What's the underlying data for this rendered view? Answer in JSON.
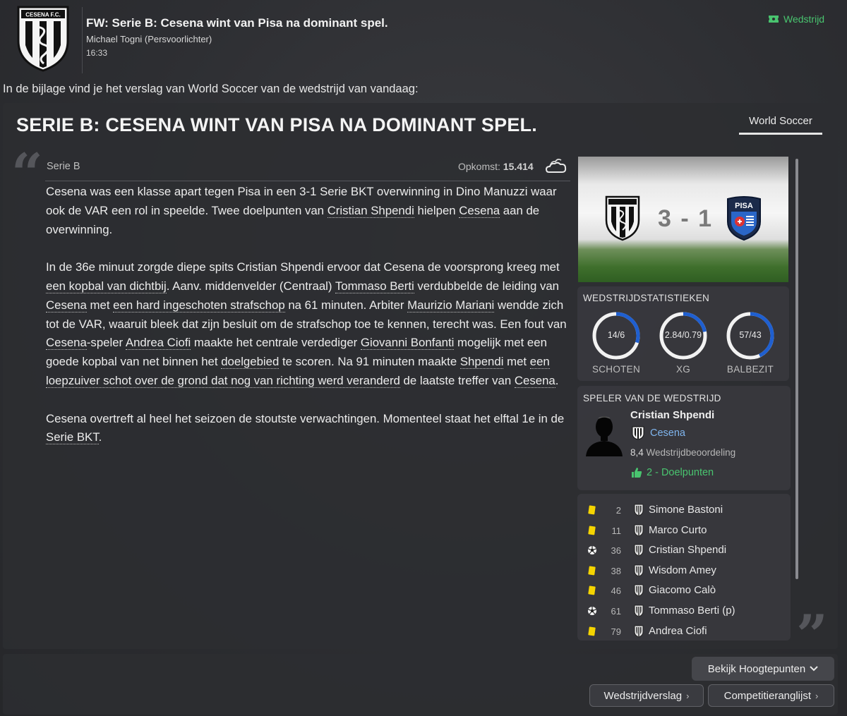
{
  "message": {
    "subject": "FW: Serie B: Cesena wint van Pisa na dominant spel.",
    "sender": "Michael Togni  (Persvoorlichter)",
    "time": "16:33",
    "tag": "Wedstrijd",
    "intro": "In de bijlage vind je het verslag van World Soccer van de wedstrijd van vandaag:"
  },
  "article": {
    "headline": "SERIE B: CESENA WINT VAN PISA NA DOMINANT SPEL.",
    "source": "World Soccer",
    "competition": "Serie B",
    "attendance_label": "Opkomst:",
    "attendance_value": "15.414",
    "weather_icon": "cloudy-icon",
    "paragraphs": [
      [
        {
          "t": "Cesena was een klasse apart tegen Pisa in een 3-1 Serie BKT overwinning in Dino Manuzzi waar ook de VAR een rol in speelde. Twee doelpunten van "
        },
        {
          "t": "Cristian Shpendi",
          "link": true
        },
        {
          "t": " hielpen "
        },
        {
          "t": "Cesena",
          "link": true
        },
        {
          "t": " aan de overwinning."
        }
      ],
      [
        {
          "t": "In de 36e minuut zorgde diepe spits Cristian Shpendi ervoor dat Cesena de voorsprong kreeg met "
        },
        {
          "t": "een kopbal van dichtbij",
          "link": true
        },
        {
          "t": ". Aanv. middenvelder (Centraal) "
        },
        {
          "t": "Tommaso Berti",
          "link": true
        },
        {
          "t": " verdubbelde de leiding van "
        },
        {
          "t": "Cesena",
          "link": true
        },
        {
          "t": " met "
        },
        {
          "t": "een hard ingeschoten strafschop",
          "link": true
        },
        {
          "t": " na 61 minuten. Arbiter "
        },
        {
          "t": "Maurizio Mariani",
          "link": true
        },
        {
          "t": " wendde zich tot de VAR, waaruit bleek dat zijn besluit om de strafschop toe te kennen, terecht was. Een fout van "
        },
        {
          "t": "Cesena",
          "link": true
        },
        {
          "t": "-speler "
        },
        {
          "t": "Andrea Ciofi",
          "link": true
        },
        {
          "t": " maakte het centrale verdediger "
        },
        {
          "t": "Giovanni Bonfanti",
          "link": true
        },
        {
          "t": " mogelijk met een goede kopbal van net binnen het "
        },
        {
          "t": "doelgebied",
          "link": true
        },
        {
          "t": " te scoren. Na 91 minuten maakte "
        },
        {
          "t": "Shpendi",
          "link": true
        },
        {
          "t": " met "
        },
        {
          "t": "een loepzuiver schot over de grond dat nog van richting werd veranderd",
          "link": true
        },
        {
          "t": " de laatste treffer van "
        },
        {
          "t": "Cesena",
          "link": true
        },
        {
          "t": "."
        }
      ],
      [
        {
          "t": "Cesena overtreft al heel het seizoen de stoutste verwachtingen. Momenteel staat het elftal 1e in de "
        },
        {
          "t": "Serie BKT",
          "link": true
        },
        {
          "t": "."
        }
      ]
    ]
  },
  "scoreboard": {
    "score": "3 - 1",
    "home_crest": "cesena-crest",
    "away_crest": "pisa-crest",
    "away_crest_text": "PISA"
  },
  "stats": {
    "title": "WEDSTRIJDSTATISTIEKEN",
    "items": [
      {
        "label": "SCHOTEN",
        "value": "14/6",
        "home_fraction": 0.7
      },
      {
        "label": "XG",
        "value": "2.84/0.79",
        "home_fraction": 0.78
      },
      {
        "label": "BALBEZIT",
        "value": "57/43",
        "home_fraction": 0.57
      }
    ],
    "ring_color": "#1f5fd0",
    "ring_track": "#f2f2f2"
  },
  "potm": {
    "title": "SPELER VAN DE WEDSTRIJD",
    "name": "Cristian Shpendi",
    "club": "Cesena",
    "rating": "8,4",
    "rating_label": "Wedstrijdbeoordeling",
    "goals": "2 - Doelpunten"
  },
  "events": [
    {
      "type": "yellow-card",
      "minute": "2",
      "player": "Simone Bastoni"
    },
    {
      "type": "yellow-card",
      "minute": "11",
      "player": "Marco Curto"
    },
    {
      "type": "goal",
      "minute": "36",
      "player": "Cristian Shpendi"
    },
    {
      "type": "yellow-card",
      "minute": "38",
      "player": "Wisdom Amey"
    },
    {
      "type": "yellow-card",
      "minute": "46",
      "player": "Giacomo Calò"
    },
    {
      "type": "goal",
      "minute": "61",
      "player": "Tommaso Berti (p)"
    },
    {
      "type": "yellow-card",
      "minute": "79",
      "player": "Andrea Ciofi"
    }
  ],
  "buttons": {
    "highlights": "Bekijk Hoogtepunten",
    "report": "Wedstrijdverslag",
    "table": "Competitieranglijst"
  }
}
